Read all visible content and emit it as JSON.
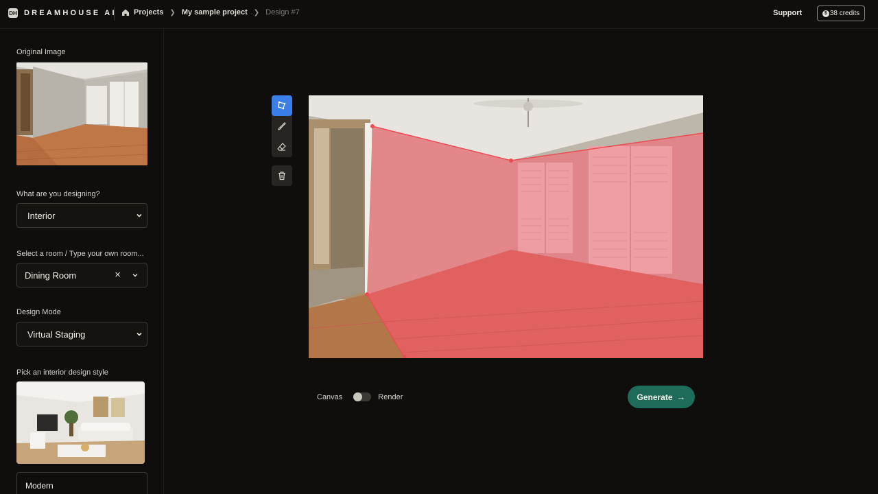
{
  "header": {
    "logo_mark": "DH",
    "brand": "DREAMHOUSE AI",
    "breadcrumbs": [
      "Projects",
      "My sample project",
      "Design #7"
    ],
    "support_label": "Support",
    "credits_label": "38 credits",
    "credits_icon": "$"
  },
  "sidebar": {
    "original_image_label": "Original Image",
    "designing_label": "What are you designing?",
    "designing_value": "Interior",
    "room_label": "Select a room / Type your own room...",
    "room_value": "Dining Room",
    "mode_label": "Design Mode",
    "mode_value": "Virtual Staging",
    "style_label": "Pick an interior design style",
    "style_value": "Modern"
  },
  "tools": {
    "items": [
      "polygon-select",
      "brush",
      "eraser"
    ],
    "active": "polygon-select",
    "delete": "trash"
  },
  "canvas": {
    "toggle_left": "Canvas",
    "toggle_right": "Render",
    "toggle_state": "Canvas"
  },
  "actions": {
    "generate_label": "Generate",
    "generate_color": "#1d6b58",
    "active_tool_color": "#3a80e8"
  }
}
